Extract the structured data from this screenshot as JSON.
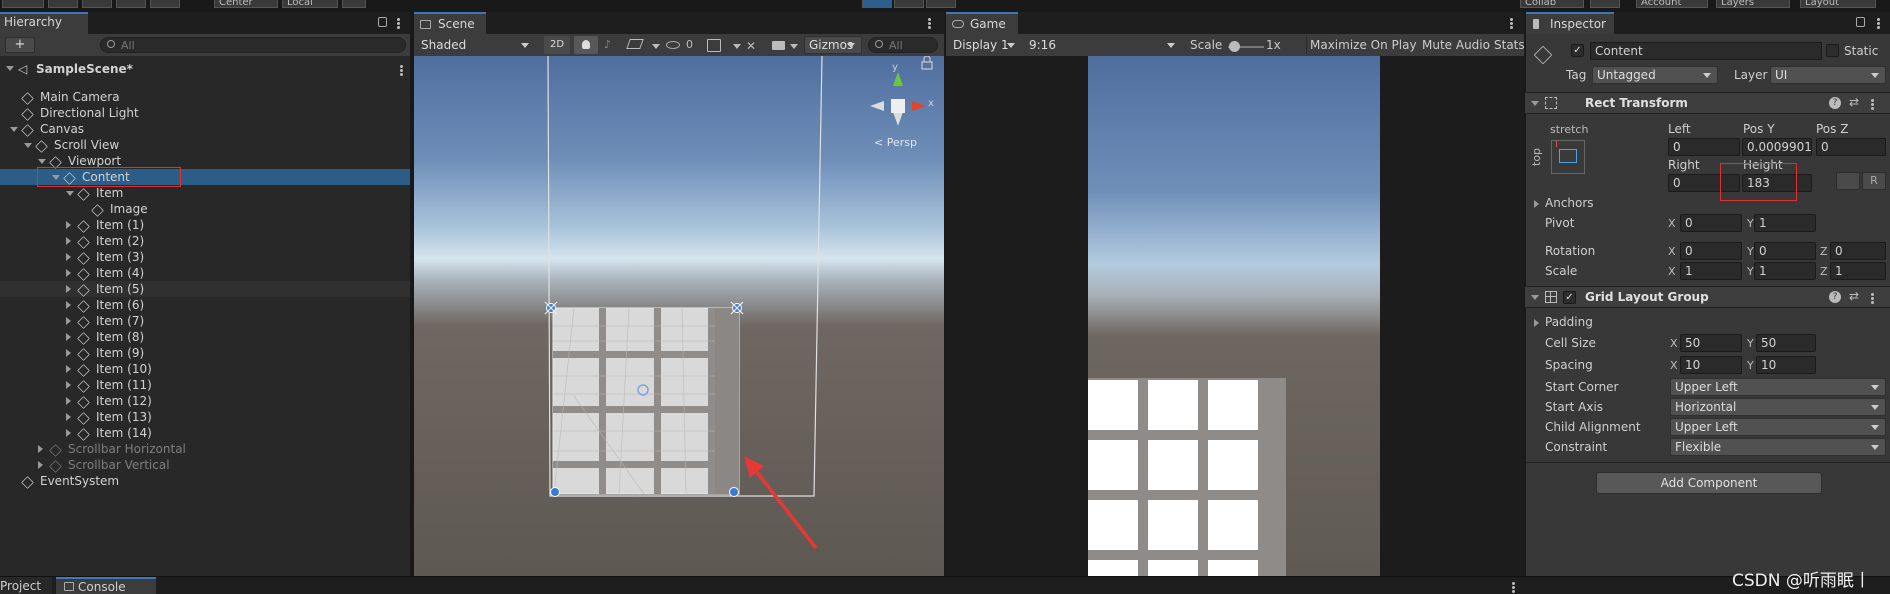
{
  "toolbar": {
    "center": "Center",
    "local": "Local",
    "collab": "Collab",
    "account": "Account",
    "layers": "Layers",
    "layout": "Layout"
  },
  "hierarchy": {
    "tab": "Hierarchy",
    "search_placeholder": "All",
    "scene": "SampleScene*",
    "items": [
      {
        "label": "Main Camera"
      },
      {
        "label": "Directional Light"
      },
      {
        "label": "Canvas"
      },
      {
        "label": "Scroll View"
      },
      {
        "label": "Viewport"
      },
      {
        "label": "Content"
      },
      {
        "label": "Item"
      },
      {
        "label": "Image"
      },
      {
        "label": "Item (1)"
      },
      {
        "label": "Item (2)"
      },
      {
        "label": "Item (3)"
      },
      {
        "label": "Item (4)"
      },
      {
        "label": "Item (5)"
      },
      {
        "label": "Item (6)"
      },
      {
        "label": "Item (7)"
      },
      {
        "label": "Item (8)"
      },
      {
        "label": "Item (9)"
      },
      {
        "label": "Item (10)"
      },
      {
        "label": "Item (11)"
      },
      {
        "label": "Item (12)"
      },
      {
        "label": "Item (13)"
      },
      {
        "label": "Item (14)"
      },
      {
        "label": "Scrollbar Horizontal"
      },
      {
        "label": "Scrollbar Vertical"
      },
      {
        "label": "EventSystem"
      }
    ]
  },
  "scene": {
    "tab": "Scene",
    "shading": "Shaded",
    "mode_2d": "2D",
    "hidden_count": "0",
    "gizmos": "Gizmos",
    "search_placeholder": "All",
    "persp": "Persp",
    "axis_y": "y",
    "axis_x": "x"
  },
  "game": {
    "tab": "Game",
    "display": "Display 1",
    "aspect": "9:16",
    "scale_label": "Scale",
    "scale_value": "1x",
    "maximize": "Maximize On Play",
    "mute": "Mute Audio",
    "stats": "Stats"
  },
  "inspector": {
    "tab": "Inspector",
    "object_name": "Content",
    "static": "Static",
    "tag_label": "Tag",
    "tag": "Untagged",
    "layer_label": "Layer",
    "layer": "UI",
    "rect": {
      "title": "Rect Transform",
      "stretch": "stretch",
      "top": "top",
      "left_label": "Left",
      "left": "0",
      "posy_label": "Pos Y",
      "posy": "0.00099013",
      "posz_label": "Pos Z",
      "posz": "0",
      "right_label": "Right",
      "right": "0",
      "height_label": "Height",
      "height": "183",
      "anchors": "Anchors",
      "pivot": "Pivot",
      "pivot_x": "0",
      "pivot_y": "1",
      "rotation": "Rotation",
      "rot_x": "0",
      "rot_y": "0",
      "rot_z": "0",
      "scale": "Scale",
      "scale_x": "1",
      "scale_y": "1",
      "scale_z": "1",
      "r_button": "R"
    },
    "grid": {
      "title": "Grid Layout Group",
      "padding": "Padding",
      "cell_size": "Cell Size",
      "cell_x": "50",
      "cell_y": "50",
      "spacing": "Spacing",
      "space_x": "10",
      "space_y": "10",
      "start_corner": "Start Corner",
      "start_corner_value": "Upper Left",
      "start_axis": "Start Axis",
      "start_axis_value": "Horizontal",
      "child_alignment": "Child Alignment",
      "child_alignment_value": "Upper Left",
      "constraint": "Constraint",
      "constraint_value": "Flexible"
    },
    "add_component": "Add Component",
    "axis_x": "X",
    "axis_y": "Y",
    "axis_z": "Z"
  },
  "bottom": {
    "project": "Project",
    "console": "Console"
  },
  "watermark": "CSDN @听雨眠丨",
  "colors": {
    "selection": "#2c5d87",
    "highlight_box": "#e03030",
    "arrow": "#e53935"
  }
}
